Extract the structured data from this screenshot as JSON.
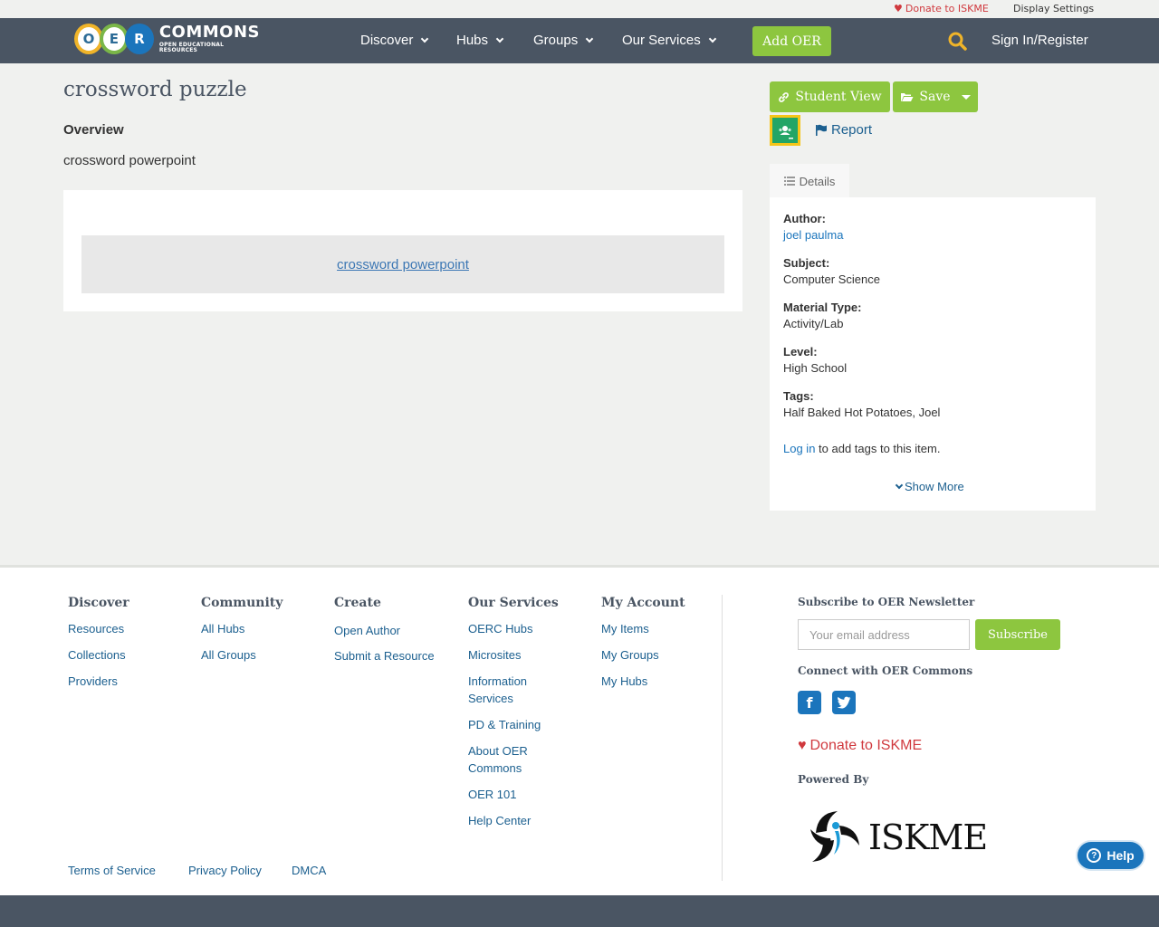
{
  "utility": {
    "donate": "Donate to ISKME",
    "display_settings": "Display Settings"
  },
  "nav": {
    "logo": {
      "letters": [
        "O",
        "E",
        "R"
      ],
      "main": "COMMONS",
      "sub": "OPEN EDUCATIONAL RESOURCES"
    },
    "items": [
      {
        "label": "Discover"
      },
      {
        "label": "Hubs"
      },
      {
        "label": "Groups"
      },
      {
        "label": "Our Services"
      }
    ],
    "add_oer": "Add OER",
    "signin": "Sign In/Register"
  },
  "page": {
    "title": "crossword puzzle",
    "overview_label": "Overview",
    "overview_text": "crossword powerpoint",
    "content_link": "crossword powerpoint"
  },
  "actions": {
    "student_view": "Student View",
    "save": "Save",
    "report": "Report",
    "details_tab": "Details"
  },
  "details": {
    "author_label": "Author:",
    "author": "joel paulma",
    "subject_label": "Subject:",
    "subject": "Computer Science",
    "material_label": "Material Type:",
    "material": "Activity/Lab",
    "level_label": "Level:",
    "level": "High School",
    "tags_label": "Tags:",
    "tags": "Half Baked Hot Potatoes, Joel",
    "login_link": "Log in",
    "login_rest": " to add tags to this item.",
    "show_more": "Show More"
  },
  "footer": {
    "discover": {
      "head": "Discover",
      "links": [
        "Resources",
        "Collections",
        "Providers"
      ]
    },
    "community": {
      "head": "Community",
      "links": [
        "All Hubs",
        "All Groups"
      ]
    },
    "create": {
      "head": "Create",
      "links": [
        "Open Author",
        "Submit a Resource"
      ]
    },
    "services": {
      "head": "Our Services",
      "links": [
        "OERC Hubs",
        "Microsites",
        "Information Services",
        "PD & Training",
        "About OER Commons",
        "OER 101",
        "Help Center"
      ]
    },
    "account": {
      "head": "My Account",
      "links": [
        "My Items",
        "My Groups",
        "My Hubs"
      ]
    },
    "newsletter_head": "Subscribe to OER Newsletter",
    "email_placeholder": "Your email address",
    "subscribe": "Subscribe",
    "connect_head": "Connect with OER Commons",
    "donate": "Donate to ISKME",
    "powered_by": "Powered By",
    "iskme": "ISKME",
    "legal": [
      "Terms of Service",
      "Privacy Policy",
      "DMCA"
    ]
  },
  "help": "Help",
  "colors": {
    "nav": "#4a5563",
    "green": "#8dc63f",
    "link": "#1b5f8f",
    "donate": "#d0393e"
  }
}
